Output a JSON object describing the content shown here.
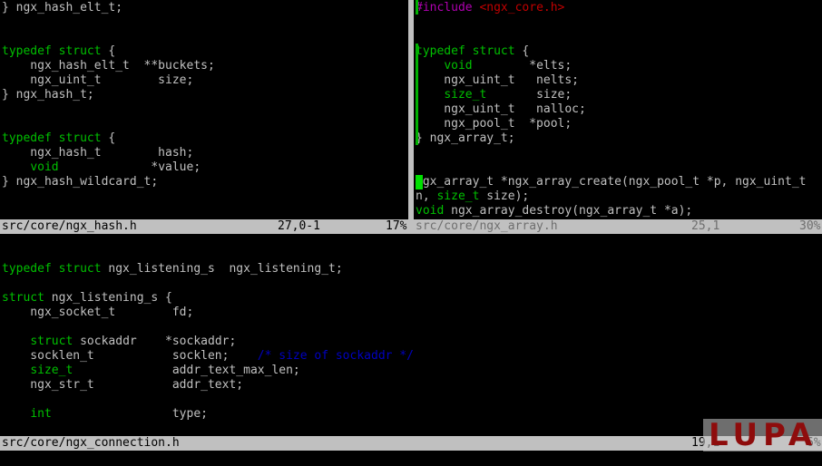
{
  "left_pane": {
    "lines": [
      "} ngx_hash_elt_t;",
      "",
      "",
      "typedef struct {",
      "    ngx_hash_elt_t  **buckets;",
      "    ngx_uint_t        size;",
      "} ngx_hash_t;",
      "",
      "",
      "typedef struct {",
      "    ngx_hash_t        hash;",
      "    void             *value;",
      "} ngx_hash_wildcard_t;",
      "",
      ""
    ],
    "status": {
      "filename": "src/core/ngx_hash.h",
      "position": "27,0-1",
      "percent": "17%"
    }
  },
  "right_pane": {
    "lines": [
      "#include <ngx_core.h>",
      "",
      "",
      "typedef struct {",
      "    void        *elts;",
      "    ngx_uint_t   nelts;",
      "    size_t       size;",
      "    ngx_uint_t   nalloc;",
      "    ngx_pool_t  *pool;",
      "} ngx_array_t;",
      "",
      "",
      "ngx_array_t *ngx_array_create(ngx_pool_t *p, ngx_uint_t",
      "n, size_t size);",
      "void ngx_array_destroy(ngx_array_t *a);"
    ],
    "status": {
      "filename": "src/core/ngx_array.h",
      "position": "25,1",
      "percent": "30%"
    }
  },
  "bottom_pane": {
    "lines": [
      "",
      "",
      "typedef struct ngx_listening_s  ngx_listening_t;",
      "",
      "struct ngx_listening_s {",
      "    ngx_socket_t        fd;",
      "",
      "    struct sockaddr    *sockaddr;",
      "    socklen_t           socklen;    /* size of sockaddr */",
      "    size_t              addr_text_max_len;",
      "    ngx_str_t           addr_text;",
      "",
      "    int                 type;",
      "",
      ""
    ],
    "status": {
      "filename": "src/core/ngx_connection.h",
      "position": "19,1",
      "percent": "6%"
    }
  },
  "watermark": {
    "text": "LUPA"
  },
  "colors": {
    "background": "#000000",
    "text": "#c0c0c0",
    "keyword": "#00c000",
    "preprocessor": "#b000b0",
    "string": "#c00000",
    "comment": "#0000c0",
    "statusbar": "#c0c0c0"
  }
}
